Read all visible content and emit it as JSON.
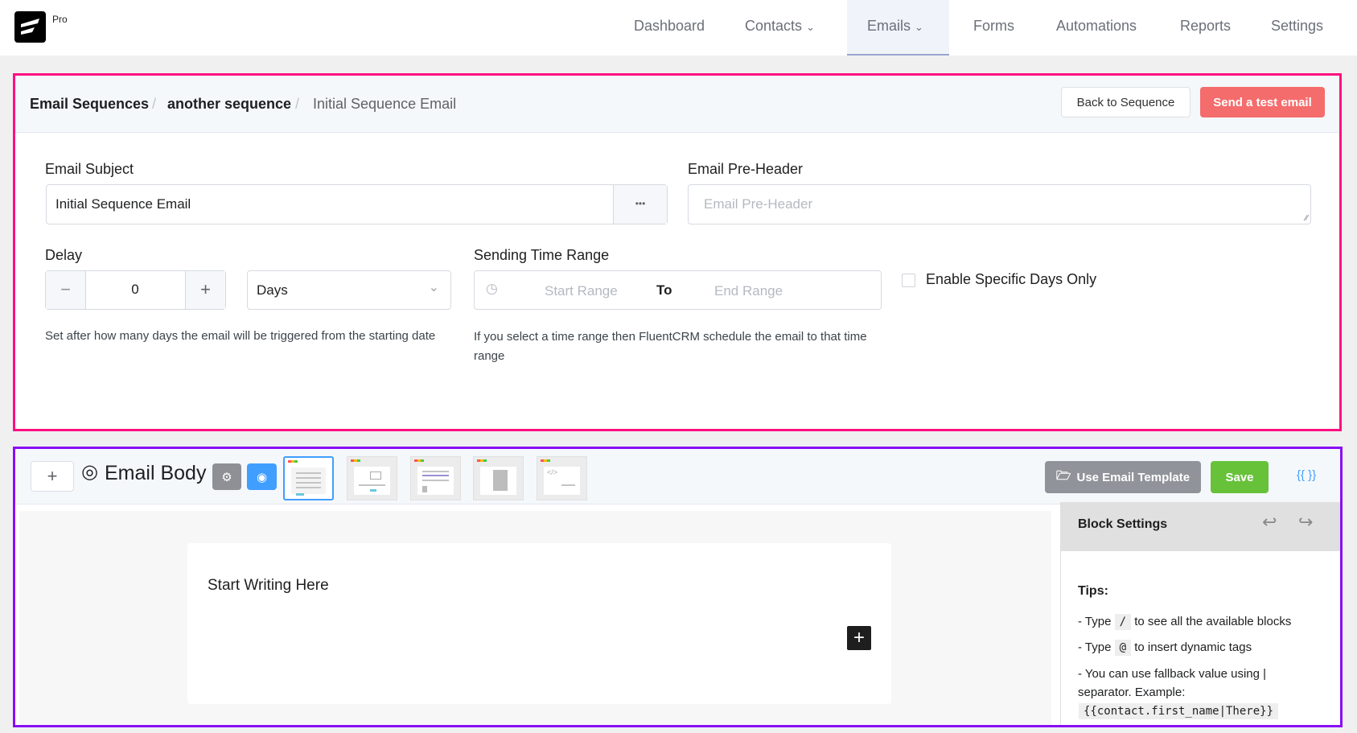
{
  "brand": {
    "badge": "Pro"
  },
  "nav": {
    "items": [
      {
        "label": "Dashboard"
      },
      {
        "label": "Contacts",
        "dropdown": true
      },
      {
        "label": "Emails",
        "dropdown": true,
        "active": true
      },
      {
        "label": "Forms"
      },
      {
        "label": "Automations"
      },
      {
        "label": "Reports"
      },
      {
        "label": "Settings"
      }
    ]
  },
  "breadcrumb": {
    "items": [
      "Email Sequences",
      "another sequence",
      "Initial Sequence Email"
    ],
    "separator": "/"
  },
  "header_buttons": {
    "back": "Back to Sequence",
    "send_test": "Send a test email"
  },
  "form": {
    "subject_label": "Email Subject",
    "subject_value": "Initial Sequence Email",
    "subject_more": "•••",
    "preheader_label": "Email Pre-Header",
    "preheader_placeholder": "Email Pre-Header",
    "delay_label": "Delay",
    "delay_value": "0",
    "delay_minus": "−",
    "delay_plus": "+",
    "delay_unit": "Days",
    "delay_help": "Set after how many days the email will be triggered from the starting date",
    "time_range_label": "Sending Time Range",
    "start_placeholder": "Start Range",
    "to": "To",
    "end_placeholder": "End Range",
    "time_range_help": "If you select a time range then FluentCRM schedule the email to that time range",
    "specific_days_label": "Enable Specific Days Only",
    "specific_days_checked": false
  },
  "editor": {
    "add": "+",
    "title": "Email Body",
    "use_template": "Use Email Template",
    "save": "Save",
    "smartcodes": "{{ }}",
    "placeholder": "Start Writing Here",
    "block_add": "+",
    "templates": [
      "simple",
      "visual",
      "classic",
      "plain",
      "raw-html"
    ],
    "selected_template": 0
  },
  "block_settings": {
    "title": "Block Settings",
    "tips_title": "Tips:",
    "tip1_pre": "- Type",
    "tip1_code": "/",
    "tip1_post": "to see all the available blocks",
    "tip2_pre": "- Type",
    "tip2_code": "@",
    "tip2_post": "to insert dynamic tags",
    "tip3": "- You can use fallback value using | separator. Example:",
    "tip3_code": "{{contact.first_name|There}}"
  },
  "colors": {
    "primary": "#409eff",
    "danger": "#f56c6c",
    "success": "#67c23a",
    "info": "#909399",
    "pink_outline": "#ff0f80",
    "purple_outline": "#8a0cf7"
  }
}
